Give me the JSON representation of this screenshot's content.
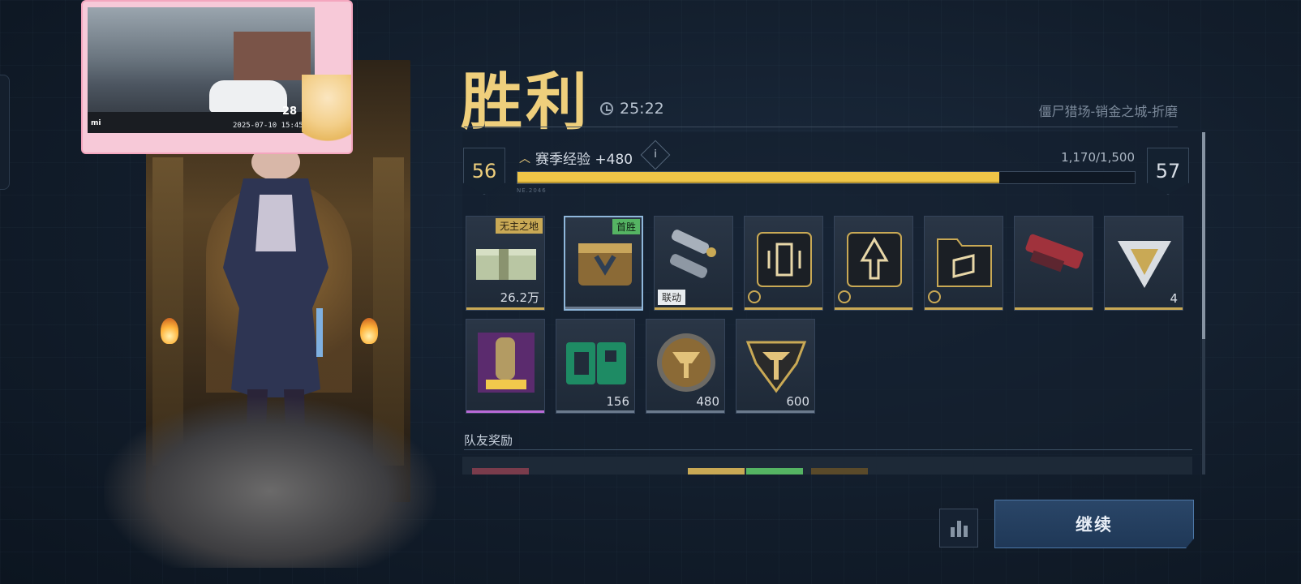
{
  "header": {
    "title": "胜利",
    "duration": "25:22",
    "mode": "僵尸猎场-销金之城-折磨"
  },
  "progress": {
    "current_level": "56",
    "next_level": "57",
    "exp_label": "赛季经验 +480",
    "info": "i",
    "exp_value": "1,170/1,500",
    "exp_fraction": 0.78,
    "code": "NE.2046"
  },
  "rewards": [
    {
      "name": "cash-bundle",
      "tag": "无主之地",
      "qty": "26.2万"
    },
    {
      "name": "supply-crate",
      "tag": "首胜",
      "qty": ""
    },
    {
      "name": "weapon-parts",
      "tag": "联动",
      "qty": ""
    },
    {
      "name": "card-module",
      "tag": "",
      "qty": ""
    },
    {
      "name": "rocket-module",
      "tag": "",
      "qty": ""
    },
    {
      "name": "swap-folder",
      "tag": "",
      "qty": ""
    },
    {
      "name": "red-gun",
      "tag": "",
      "qty": ""
    },
    {
      "name": "prism-shard",
      "tag": "",
      "qty": "4"
    },
    {
      "name": "poster-card",
      "tag": "",
      "qty": ""
    },
    {
      "name": "gp-points",
      "tag": "",
      "qty": "156"
    },
    {
      "name": "gold-coin",
      "tag": "",
      "qty": "480"
    },
    {
      "name": "emblem-token",
      "tag": "",
      "qty": "600"
    }
  ],
  "teammates": {
    "title": "队友奖励"
  },
  "actions": {
    "continue_label": "继续"
  },
  "stream_overlay": {
    "timestamp": "2025-07-10 15:45:53",
    "speed": "28"
  },
  "colors": {
    "gold": "#efcf7c",
    "exp_bar": "#efc547",
    "first_win_tag": "#55b463",
    "button": "#1f3857"
  }
}
